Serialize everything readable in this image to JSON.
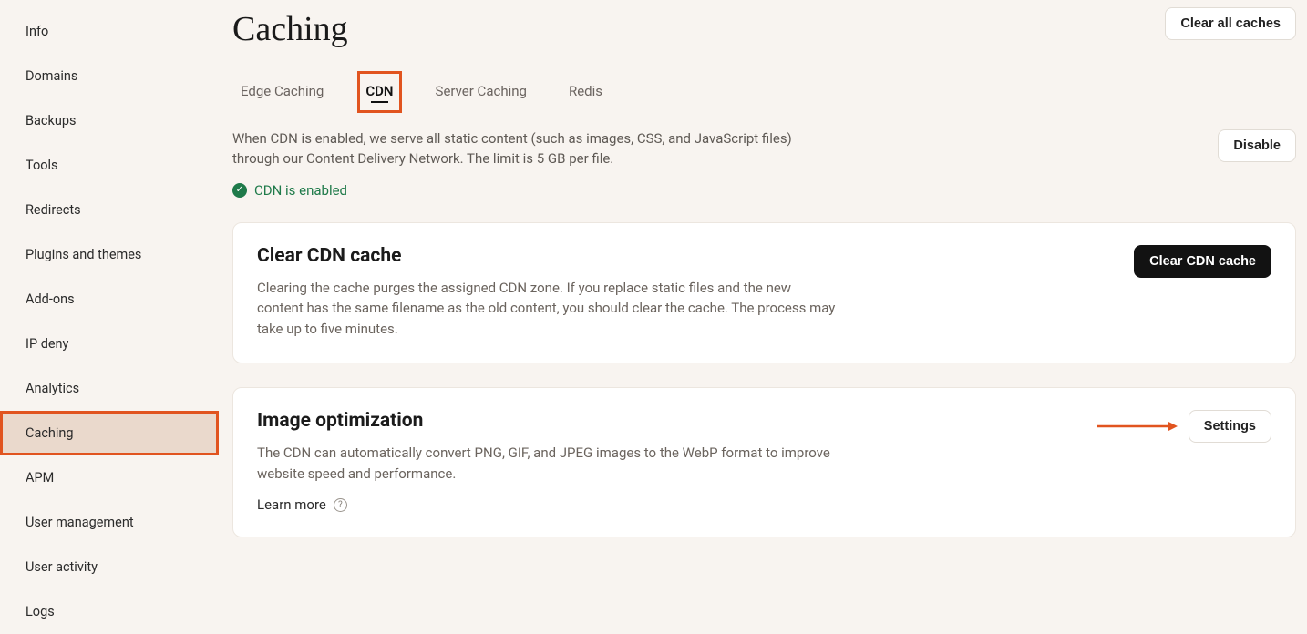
{
  "sidebar": {
    "items": [
      {
        "label": "Info"
      },
      {
        "label": "Domains"
      },
      {
        "label": "Backups"
      },
      {
        "label": "Tools"
      },
      {
        "label": "Redirects"
      },
      {
        "label": "Plugins and themes"
      },
      {
        "label": "Add-ons"
      },
      {
        "label": "IP deny"
      },
      {
        "label": "Analytics"
      },
      {
        "label": "Caching"
      },
      {
        "label": "APM"
      },
      {
        "label": "User management"
      },
      {
        "label": "User activity"
      },
      {
        "label": "Logs"
      }
    ],
    "active_index": 9
  },
  "page": {
    "title": "Caching",
    "clear_all_label": "Clear all caches"
  },
  "tabs": {
    "items": [
      {
        "label": "Edge Caching"
      },
      {
        "label": "CDN"
      },
      {
        "label": "Server Caching"
      },
      {
        "label": "Redis"
      }
    ],
    "active_index": 1,
    "description": "When CDN is enabled, we serve all static content (such as images, CSS, and JavaScript files) through our Content Delivery Network. The limit is 5 GB per file.",
    "disable_label": "Disable",
    "status_text": "CDN is enabled"
  },
  "cards": {
    "clear_cdn": {
      "title": "Clear CDN cache",
      "desc": "Clearing the cache purges the assigned CDN zone. If you replace static files and the new content has the same filename as the old content, you should clear the cache. The process may take up to five minutes.",
      "button_label": "Clear CDN cache"
    },
    "image_opt": {
      "title": "Image optimization",
      "desc": "The CDN can automatically convert PNG, GIF, and JPEG images to the WebP format to improve website speed and performance.",
      "learn_more_label": "Learn more",
      "settings_label": "Settings"
    }
  }
}
